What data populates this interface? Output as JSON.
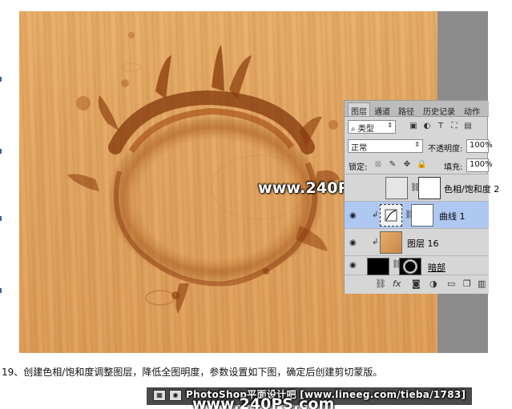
{
  "watermark": {
    "main": "www.240PS.com",
    "strip": "PhotoShop平面设计吧 [www.lineeg.com/tieba/1783]",
    "strip_small": "B... ...",
    "bottom": "www.240PS.com"
  },
  "panel": {
    "tabs": [
      "图层",
      "通道",
      "路径",
      "历史记录",
      "动作"
    ],
    "filter_label": "类型",
    "blend_mode": "正常",
    "opacity_label": "不透明度:",
    "opacity_value": "100%",
    "lock_label": "锁定:",
    "fill_label": "填充:",
    "fill_value": "100%",
    "layers": [
      {
        "name": "色相/饱和度 2",
        "visible": false,
        "selected": false,
        "clipped": false
      },
      {
        "name": "曲线 1",
        "visible": true,
        "selected": true,
        "clipped": true
      },
      {
        "name": "图层 16",
        "visible": true,
        "selected": false,
        "clipped": true
      },
      {
        "name": "暗部",
        "visible": true,
        "selected": false,
        "clipped": false
      }
    ]
  },
  "caption": "19、创建色相/饱和度调整图层，降低全图明度，参数设置如下图，确定后创建剪切蒙版。",
  "icons": [
    "eye-icon",
    "link-icon",
    "fx-icon",
    "mask-icon",
    "adjustment-icon",
    "folder-icon",
    "new-layer-icon",
    "trash-icon",
    "lock-icon",
    "brush-icon",
    "move-icon"
  ],
  "colors": {
    "wood": "#e4a763",
    "selected_row": "#aec8f2",
    "panel_bg": "#d6d6d6"
  }
}
